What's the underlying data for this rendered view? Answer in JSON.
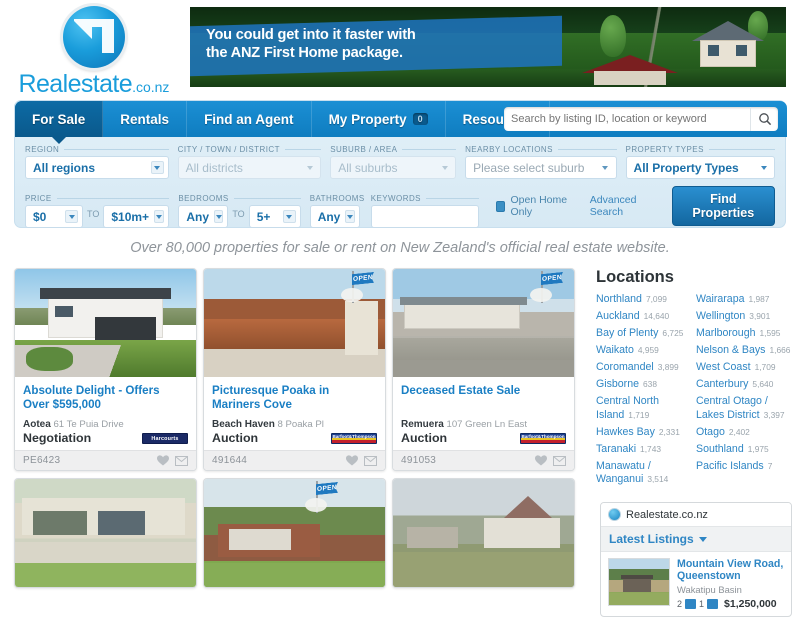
{
  "brand": {
    "name": "Realestate",
    "suffix": ".co.nz",
    "logo_icon": "realestate-nz-logo"
  },
  "banner": {
    "line1": "You could get into it faster with",
    "line2": "the ANZ First Home package.",
    "advertiser": "ANZ"
  },
  "nav": {
    "tabs": [
      {
        "label": "For Sale",
        "active": true
      },
      {
        "label": "Rentals",
        "active": false
      },
      {
        "label": "Find an Agent",
        "active": false
      },
      {
        "label": "My Property",
        "active": false,
        "badge": "0"
      },
      {
        "label": "Resources",
        "active": false
      }
    ]
  },
  "search": {
    "placeholder": "Search by listing ID, location or keyword",
    "value": "",
    "icon": "search-icon"
  },
  "filters": {
    "region": {
      "label": "REGION",
      "value": "All regions"
    },
    "city": {
      "label": "CITY / TOWN / DISTRICT",
      "value": "All districts"
    },
    "suburb": {
      "label": "SUBURB / AREA",
      "value": "All suburbs"
    },
    "nearby": {
      "label": "NEARBY LOCATIONS",
      "value": "Please select suburb"
    },
    "property_types": {
      "label": "PROPERTY TYPES",
      "value": "All Property Types"
    },
    "price": {
      "label": "PRICE",
      "min": "$0",
      "max": "$10m+",
      "to": "TO"
    },
    "bedrooms": {
      "label": "BEDROOMS",
      "min": "Any",
      "max": "5+",
      "to": "TO"
    },
    "bathrooms": {
      "label": "BATHROOMS",
      "value": "Any"
    },
    "keywords": {
      "label": "KEYWORDS",
      "value": ""
    },
    "open_home_only": {
      "label": "Open Home Only",
      "checked": true
    },
    "advanced_search": "Advanced Search",
    "submit": "Find Properties"
  },
  "tagline": "Over 80,000 properties for sale or rent on New Zealand's official real estate website.",
  "listings": {
    "row1": [
      {
        "title": "Absolute Delight - Offers Over $595,000",
        "suburb": "Aotea",
        "address": "61 Te Puia Drive",
        "price": "Negotiation",
        "ref": "PE6423",
        "agency": "Harcourts",
        "agency_style": "harcourts",
        "open_home": false
      },
      {
        "title": "Picturesque Poaka in Mariners Cove",
        "suburb": "Beach Haven",
        "address": "8 Poaka Pl",
        "price": "Auction",
        "ref": "491644",
        "agency": "Barfoot & Thompson",
        "agency_style": "barfoot",
        "open_home": true
      },
      {
        "title": "Deceased Estate Sale",
        "suburb": "Remuera",
        "address": "107 Green Ln East",
        "price": "Auction",
        "ref": "491053",
        "agency": "Barfoot & Thompson",
        "agency_style": "barfoot",
        "open_home": true
      }
    ],
    "row2": [
      {
        "open_home": false
      },
      {
        "open_home": true
      },
      {
        "open_home": false
      }
    ],
    "icons": {
      "favourite": "heart-icon",
      "email": "envelope-icon"
    }
  },
  "locations": {
    "title": "Locations",
    "left": [
      {
        "name": "Northland",
        "count": "7,099"
      },
      {
        "name": "Auckland",
        "count": "14,640"
      },
      {
        "name": "Bay of Plenty",
        "count": "6,725"
      },
      {
        "name": "Waikato",
        "count": "4,959"
      },
      {
        "name": "Coromandel",
        "count": "3,899"
      },
      {
        "name": "Gisborne",
        "count": "638"
      },
      {
        "name": "Central North Island",
        "count": "1,719"
      },
      {
        "name": "Hawkes Bay",
        "count": "2,331"
      },
      {
        "name": "Taranaki",
        "count": "1,743"
      },
      {
        "name": "Manawatu / Wanganui",
        "count": "3,514"
      }
    ],
    "right": [
      {
        "name": "Wairarapa",
        "count": "1,987"
      },
      {
        "name": "Wellington",
        "count": "3,901"
      },
      {
        "name": "Marlborough",
        "count": "1,595"
      },
      {
        "name": "Nelson & Bays",
        "count": "1,666"
      },
      {
        "name": "West Coast",
        "count": "1,709"
      },
      {
        "name": "Canterbury",
        "count": "5,640"
      },
      {
        "name": "Central Otago / Lakes District",
        "count": "3,397"
      },
      {
        "name": "Otago",
        "count": "2,402"
      },
      {
        "name": "Southland",
        "count": "1,975"
      },
      {
        "name": "Pacific Islands",
        "count": "7"
      }
    ]
  },
  "widget": {
    "brand": "Realestate.co.nz",
    "bar_label": "Latest Listings",
    "bar_icon": "chevron-down-icon",
    "item": {
      "title": "Mountain View Road, Queenstown",
      "subtitle": "Wakatipu Basin",
      "bedrooms": "2",
      "bathrooms": "1",
      "price": "$1,250,000",
      "bed_icon": "bed-icon",
      "bath_icon": "bath-icon"
    }
  }
}
